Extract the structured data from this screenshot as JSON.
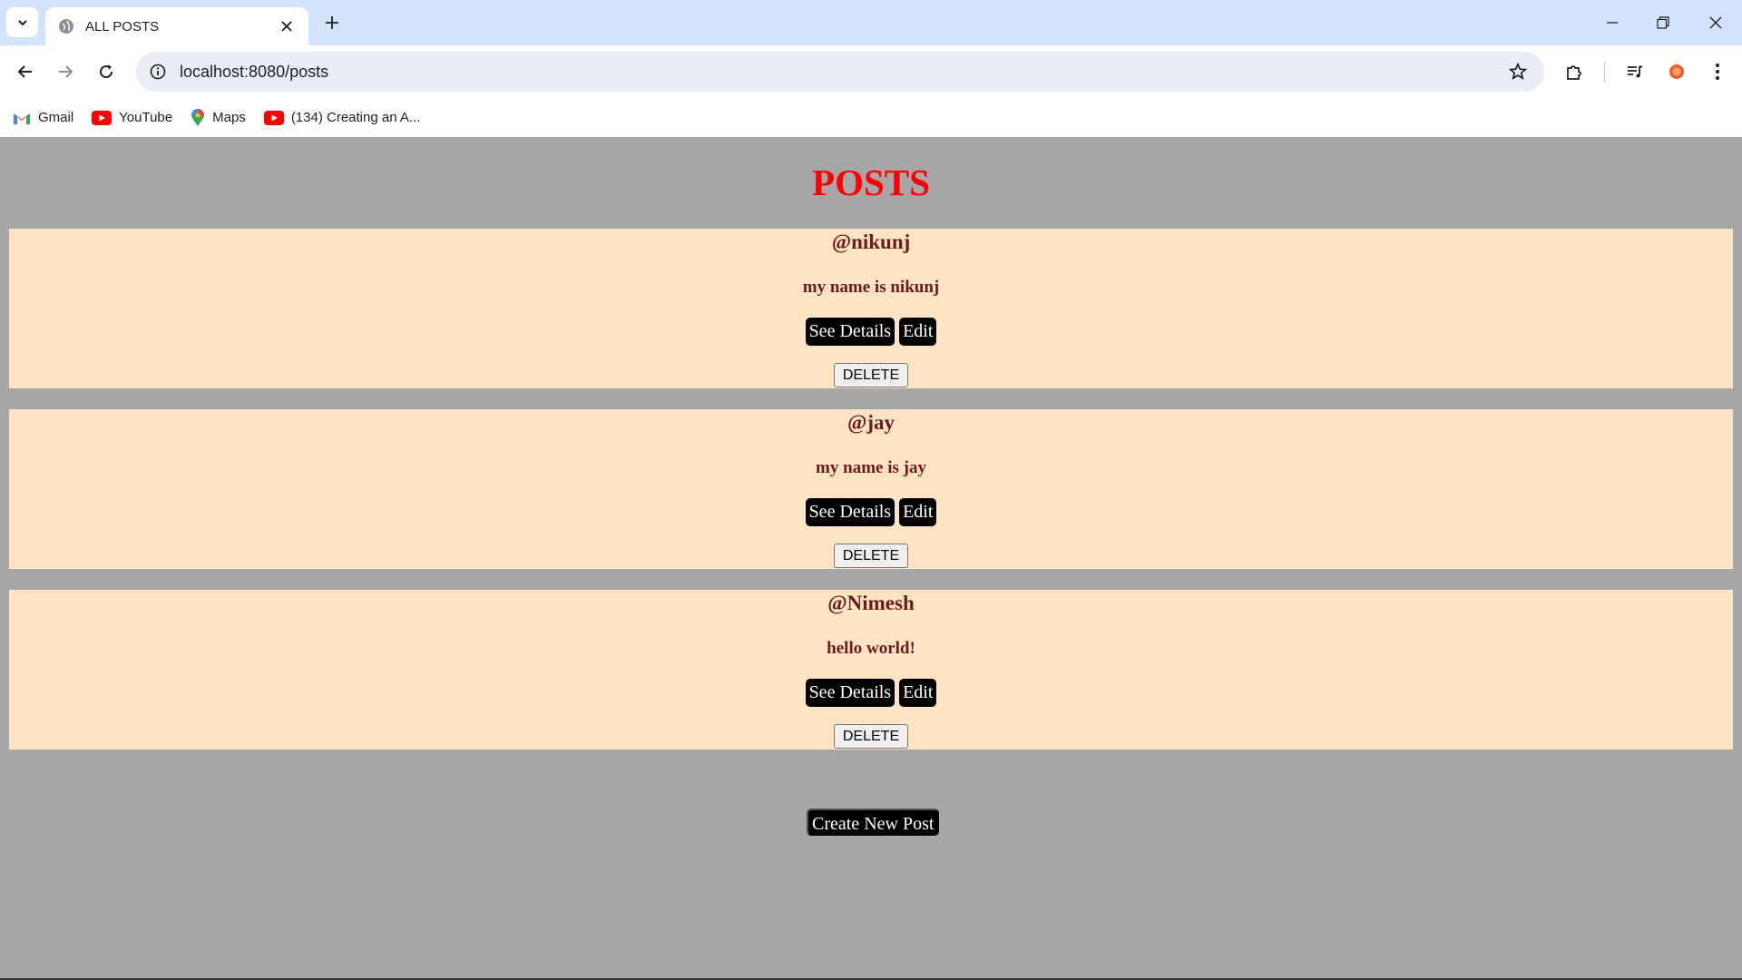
{
  "browser": {
    "tab_title": "ALL POSTS",
    "url": "localhost:8080/posts",
    "bookmarks": [
      {
        "label": "Gmail",
        "icon": "gmail-icon"
      },
      {
        "label": "YouTube",
        "icon": "youtube-icon"
      },
      {
        "label": "Maps",
        "icon": "maps-icon"
      },
      {
        "label": "(134) Creating an A...",
        "icon": "youtube-icon"
      }
    ]
  },
  "page": {
    "title": "POSTS",
    "posts": [
      {
        "username": "@nikunj",
        "content": "my name is nikunj",
        "details_label": "See Details",
        "edit_label": "Edit",
        "delete_label": "DELETE"
      },
      {
        "username": "@jay",
        "content": "my name is jay",
        "details_label": "See Details",
        "edit_label": "Edit",
        "delete_label": "DELETE"
      },
      {
        "username": "@Nimesh",
        "content": "hello world!",
        "details_label": "See Details",
        "edit_label": "Edit",
        "delete_label": "DELETE"
      }
    ],
    "create_label": "Create New Post"
  },
  "colors": {
    "page_bg": "#a6a6a6",
    "card_bg": "#ffe4c4",
    "title": "#ff0000",
    "card_text": "#6b1b1b"
  }
}
